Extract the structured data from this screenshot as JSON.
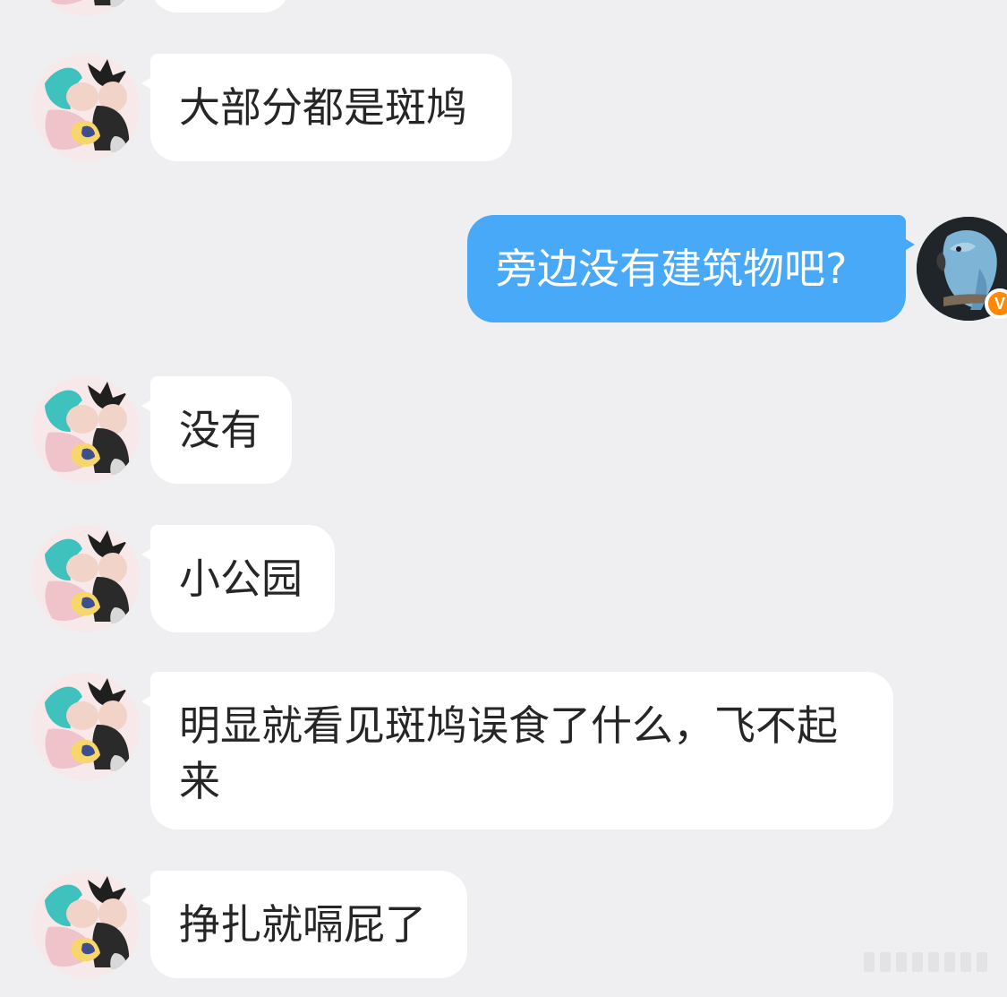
{
  "messages": [
    {
      "side": "left",
      "text": ""
    },
    {
      "side": "left",
      "text": "大部分都是斑鸠"
    },
    {
      "side": "right",
      "text": "旁边没有建筑物吧?"
    },
    {
      "side": "left",
      "text": "没有"
    },
    {
      "side": "left",
      "text": "小公园"
    },
    {
      "side": "left",
      "text": "明显就看见斑鸠误食了什么，飞不起来"
    },
    {
      "side": "left",
      "text": "挣扎就嗝屁了"
    }
  ],
  "icons": {
    "left_avatar": "cartoon-family-avatar",
    "right_avatar": "parrot-avatar",
    "verified_badge": "verified-v-badge"
  },
  "colors": {
    "background": "#efeff1",
    "incoming_bubble": "#ffffff",
    "outgoing_bubble": "#48a9f8",
    "badge": "#ff8a00"
  }
}
